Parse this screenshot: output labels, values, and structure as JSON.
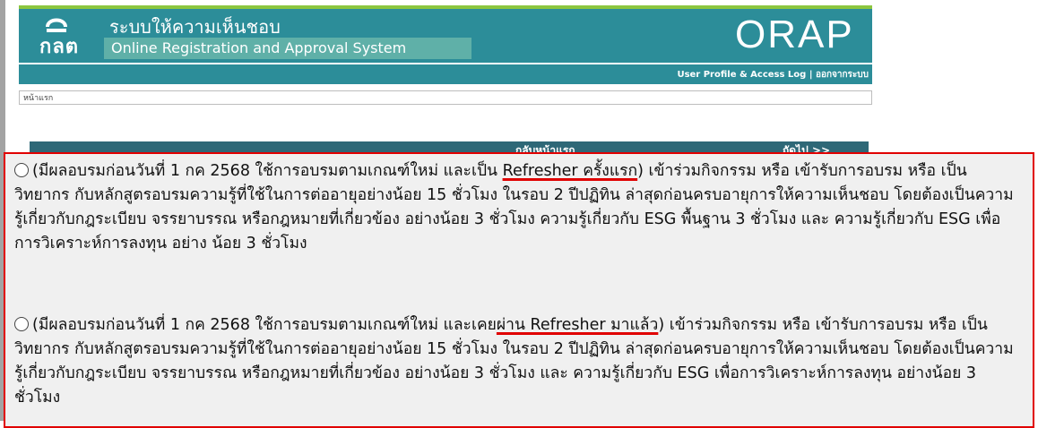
{
  "header": {
    "logo_text": "กลต",
    "title_th": "ระบบให้ความเห็นชอบ",
    "title_en": "Online Registration and Approval System",
    "brand": "ORAP"
  },
  "userbar": {
    "profile_link": "User Profile & Access Log",
    "separator": "|",
    "logout_link": "ออกจากระบบ"
  },
  "breadcrumb": {
    "home": "หน้าแรก"
  },
  "nav": {
    "back": "กลับหน้าแรก",
    "next": "ถัดไป >>"
  },
  "options": [
    {
      "pre": "(มีผลอบรมก่อนวันที่ 1 กค 2568 ใช้การอบรมตามเกณฑ์ใหม่ และเป็น ",
      "highlight": "Refresher ครั้งแรก",
      "post": ") เข้าร่วมกิจกรรม หรือ เข้ารับการอบรม หรือ เป็นวิทยากร กับหลักสูตรอบรมความรู้ที่ใช้ในการต่ออายุอย่างน้อย 15 ชั่วโมง ในรอบ 2 ปีปฏิทิน ล่าสุดก่อนครบอายุการให้ความเห็นชอบ โดยต้องเป็นความรู้เกี่ยวกับกฎระเบียบ จรรยาบรรณ หรือกฎหมายที่เกี่ยวข้อง อย่างน้อย 3 ชั่วโมง ความรู้เกี่ยวกับ ESG พื้นฐาน 3 ชั่วโมง และ ความรู้เกี่ยวกับ ESG เพื่อการวิเคราะห์การลงทุน อย่าง น้อย 3 ชั่วโมง"
    },
    {
      "pre": "(มีผลอบรมก่อนวันที่ 1 กค 2568 ใช้การอบรมตามเกณฑ์ใหม่ และเคย",
      "highlight": "ผ่าน Refresher มาแล้ว",
      "post": ") เข้าร่วมกิจกรรม หรือ เข้ารับการอบรม หรือ เป็นวิทยากร กับหลักสูตรอบรมความรู้ที่ใช้ในการต่ออายุอย่างน้อย 15 ชั่วโมง ในรอบ 2 ปีปฏิทิน ล่าสุดก่อนครบอายุการให้ความเห็นชอบ โดยต้องเป็นความรู้เกี่ยวกับกฎระเบียบ จรรยาบรรณ หรือกฎหมายที่เกี่ยวข้อง อย่างน้อย 3 ชั่วโมง และ ความรู้เกี่ยวกับ ESG เพื่อการวิเคราะห์การลงทุน อย่างน้อย 3 ชั่วโมง"
    }
  ],
  "colors": {
    "teal": "#2c8d99",
    "nav": "#2e6877",
    "highlight_border": "#e00000"
  }
}
